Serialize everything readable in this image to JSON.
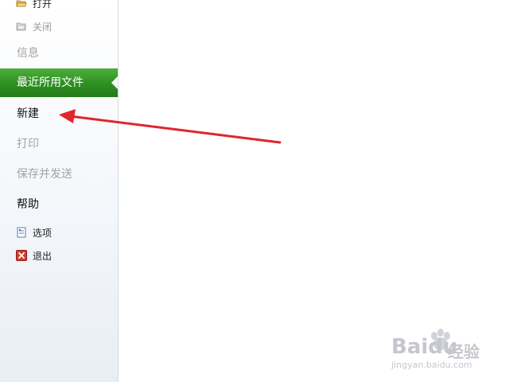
{
  "menu": {
    "open_label": "打开",
    "close_label": "关闭",
    "info_label": "信息",
    "recent_label": "最近所用文件",
    "new_label": "新建",
    "print_label": "打印",
    "save_send_label": "保存并发送",
    "help_label": "帮助",
    "options_label": "选项",
    "exit_label": "退出"
  },
  "colors": {
    "selected_green": "#2f8f22",
    "annotation_red": "#e0252b"
  },
  "icons": {
    "open": "folder-open-icon",
    "close": "folder-close-icon",
    "options": "options-doc-icon",
    "exit": "exit-x-icon"
  },
  "watermark": {
    "brand": "Bai",
    "brand2": "du",
    "cn": "经验",
    "url": "jingyan.baidu.com"
  }
}
